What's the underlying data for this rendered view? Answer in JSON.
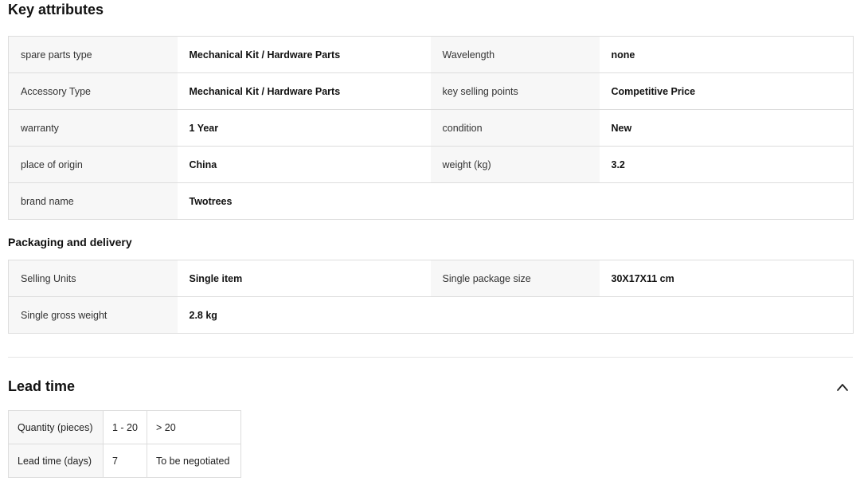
{
  "key_attributes": {
    "title": "Key attributes",
    "rows": [
      [
        {
          "k": "spare parts type",
          "v": "Mechanical Kit / Hardware Parts"
        },
        {
          "k": "Wavelength",
          "v": "none"
        }
      ],
      [
        {
          "k": "Accessory Type",
          "v": "Mechanical Kit / Hardware Parts"
        },
        {
          "k": "key selling points",
          "v": "Competitive Price"
        }
      ],
      [
        {
          "k": "warranty",
          "v": "1 Year"
        },
        {
          "k": "condition",
          "v": "New"
        }
      ],
      [
        {
          "k": "place of origin",
          "v": "China"
        },
        {
          "k": "weight (kg)",
          "v": "3.2"
        }
      ],
      [
        {
          "k": "brand name",
          "v": "Twotrees"
        }
      ]
    ]
  },
  "packaging": {
    "title": "Packaging and delivery",
    "rows": [
      [
        {
          "k": "Selling Units",
          "v": "Single item"
        },
        {
          "k": "Single package size",
          "v": "30X17X11 cm"
        }
      ],
      [
        {
          "k": "Single gross weight",
          "v": "2.8 kg"
        }
      ]
    ]
  },
  "lead_time": {
    "title": "Lead time",
    "collapse_icon": "chevron-up-icon",
    "quantity_label": "Quantity (pieces)",
    "quantities": [
      "1 - 20",
      "> 20"
    ],
    "days_label": "Lead time (days)",
    "days": [
      "7",
      "To be negotiated"
    ]
  }
}
